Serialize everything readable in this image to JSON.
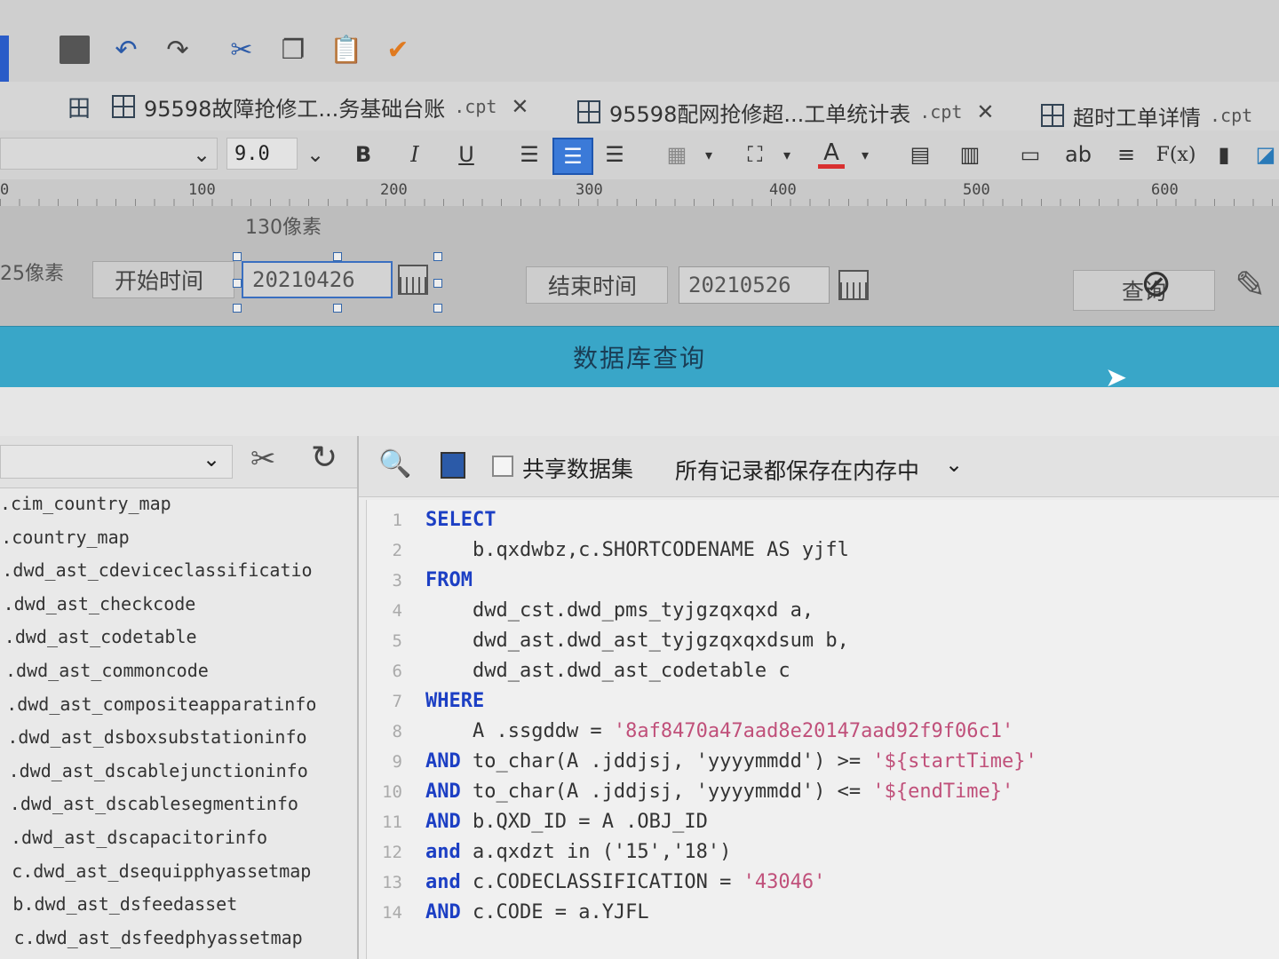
{
  "toolbar": {
    "icons": [
      "save-icon",
      "undo-icon",
      "redo-icon",
      "cut-icon",
      "copy-icon",
      "paste-icon",
      "format-painter-icon"
    ]
  },
  "tabs": [
    {
      "name": "95598故障抢修工...务基础台账",
      "ext": ".cpt"
    },
    {
      "name": "95598配网抢修超...工单统计表",
      "ext": ".cpt"
    },
    {
      "name": "超时工单详情",
      "ext": ".cpt"
    }
  ],
  "format": {
    "font_size": "9.0",
    "bold": "B",
    "italic": "I",
    "underline": "U",
    "text_label": "ab",
    "formula_label": "F(x)",
    "font_color": "#d93030",
    "active_color": "#3b7ad8"
  },
  "ruler": {
    "marks": [
      "0",
      "100",
      "200",
      "300",
      "400",
      "500",
      "600"
    ]
  },
  "param": {
    "width_hint": "130像素",
    "height_hint": "25像素",
    "start_label": "开始时间",
    "start_value": "20210426",
    "end_label": "结束时间",
    "end_value": "20210526",
    "query_button": "查询"
  },
  "query_bar": {
    "title": "数据库查询",
    "color": "#39a6c8"
  },
  "left_panel": {
    "tables": [
      ".cim_country_map",
      ".country_map",
      ".dwd_ast_cdeviceclassificatio",
      ".dwd_ast_checkcode",
      ".dwd_ast_codetable",
      ".dwd_ast_commoncode",
      ".dwd_ast_compositeapparatinfo",
      ".dwd_ast_dsboxsubstationinfo",
      ".dwd_ast_dscablejunctioninfo",
      ".dwd_ast_dscablesegmentinfo",
      ".dwd_ast_dscapacitorinfo",
      "c.dwd_ast_dsequipphyassetmap",
      "b.dwd_ast_dsfeedasset",
      "c.dwd_ast_dsfeedphyassetmap"
    ]
  },
  "right_panel": {
    "shared_dataset_label": "共享数据集",
    "memory_option": "所有记录都保存在内存中"
  },
  "sql": [
    {
      "ln": "1",
      "kw": "SELECT",
      "rest": "",
      "str": ""
    },
    {
      "ln": "2",
      "kw": "",
      "rest": "    b.qxdwbz,c.SHORTCODENAME AS yjfl",
      "str": ""
    },
    {
      "ln": "3",
      "kw": "FROM",
      "rest": "",
      "str": ""
    },
    {
      "ln": "4",
      "kw": "",
      "rest": "    dwd_cst.dwd_pms_tyjgzqxqxd a,",
      "str": ""
    },
    {
      "ln": "5",
      "kw": "",
      "rest": "    dwd_ast.dwd_ast_tyjgzqxqxdsum b,",
      "str": ""
    },
    {
      "ln": "6",
      "kw": "",
      "rest": "    dwd_ast.dwd_ast_codetable c",
      "str": ""
    },
    {
      "ln": "7",
      "kw": "WHERE",
      "rest": "",
      "str": ""
    },
    {
      "ln": "8",
      "kw": "",
      "rest": "    A .ssgddw = ",
      "str": "'8af8470a47aad8e20147aad92f9f06c1'"
    },
    {
      "ln": "9",
      "kw": "AND",
      "rest": " to_char(A .jddjsj, 'yyyymmdd') >= ",
      "str": "'${startTime}'"
    },
    {
      "ln": "10",
      "kw": "AND",
      "rest": " to_char(A .jddjsj, 'yyyymmdd') <= ",
      "str": "'${endTime}'"
    },
    {
      "ln": "11",
      "kw": "AND",
      "rest": " b.QXD_ID = A .OBJ_ID",
      "str": ""
    },
    {
      "ln": "12",
      "kw": "and",
      "rest": " a.qxdzt in ('15','18')",
      "str": ""
    },
    {
      "ln": "13",
      "kw": "and",
      "rest": " c.CODECLASSIFICATION = ",
      "str": "'43046'"
    },
    {
      "ln": "14",
      "kw": "AND",
      "rest": " c.CODE = a.YJFL",
      "str": ""
    }
  ]
}
